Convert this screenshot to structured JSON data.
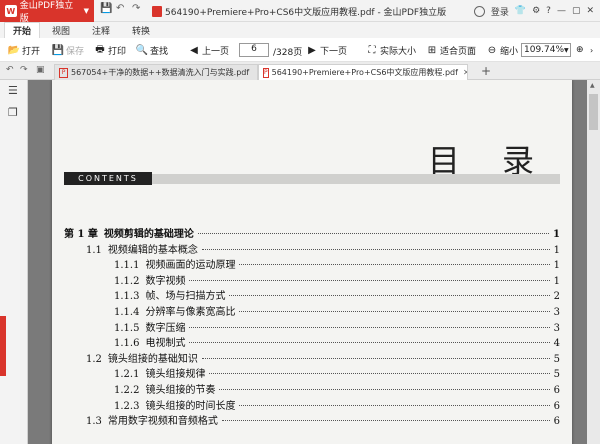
{
  "app": {
    "name": "金山PDF独立版",
    "document_title": "564190+Premiere+Pro+CS6中文版应用教程.pdf - 金山PDF独立版",
    "login_label": "登录"
  },
  "menu": {
    "tabs": [
      {
        "label": "开始",
        "active": true
      },
      {
        "label": "视图",
        "active": false
      },
      {
        "label": "注释",
        "active": false
      },
      {
        "label": "转换",
        "active": false
      }
    ]
  },
  "toolbar": {
    "open_label": "打开",
    "save_label": "保存",
    "print_label": "打印",
    "find_label": "查找",
    "prev_page_label": "上一页",
    "current_page": "6",
    "total_pages": "/328页",
    "next_page_label": "下一页",
    "actual_size_label": "实际大小",
    "fit_page_label": "适合页面",
    "zoom_out_label": "缩小",
    "zoom_value": "109.74%"
  },
  "doc_tabs": [
    {
      "label": "567054+干净的数据++数据清洗入门与实践.pdf",
      "active": false
    },
    {
      "label": "564190+Premiere+Pro+CS6中文版应用教程.pdf",
      "active": true
    }
  ],
  "page": {
    "toc_title": "目 录",
    "contents_label": "CONTENTS",
    "entries": [
      {
        "num": "第 1 章",
        "text": "视频剪辑的基础理论",
        "page": "1",
        "level": 0
      },
      {
        "num": "1.1",
        "text": "视频编辑的基本概念",
        "page": "1",
        "level": 1
      },
      {
        "num": "1.1.1",
        "text": "视频画面的运动原理",
        "page": "1",
        "level": 2
      },
      {
        "num": "1.1.2",
        "text": "数字视频",
        "page": "1",
        "level": 2
      },
      {
        "num": "1.1.3",
        "text": "帧、场与扫描方式",
        "page": "2",
        "level": 2
      },
      {
        "num": "1.1.4",
        "text": "分辨率与像素宽高比",
        "page": "3",
        "level": 2
      },
      {
        "num": "1.1.5",
        "text": "数字压缩",
        "page": "3",
        "level": 2
      },
      {
        "num": "1.1.6",
        "text": "电视制式",
        "page": "4",
        "level": 2
      },
      {
        "num": "1.2",
        "text": "镜头组接的基础知识",
        "page": "5",
        "level": 1
      },
      {
        "num": "1.2.1",
        "text": "镜头组接规律",
        "page": "5",
        "level": 2
      },
      {
        "num": "1.2.2",
        "text": "镜头组接的节奏",
        "page": "6",
        "level": 2
      },
      {
        "num": "1.2.3",
        "text": "镜头组接的时间长度",
        "page": "6",
        "level": 2
      },
      {
        "num": "1.3",
        "text": "常用数字视频和音频格式",
        "page": "6",
        "level": 1
      }
    ]
  },
  "colors": {
    "accent": "#d9342b"
  }
}
